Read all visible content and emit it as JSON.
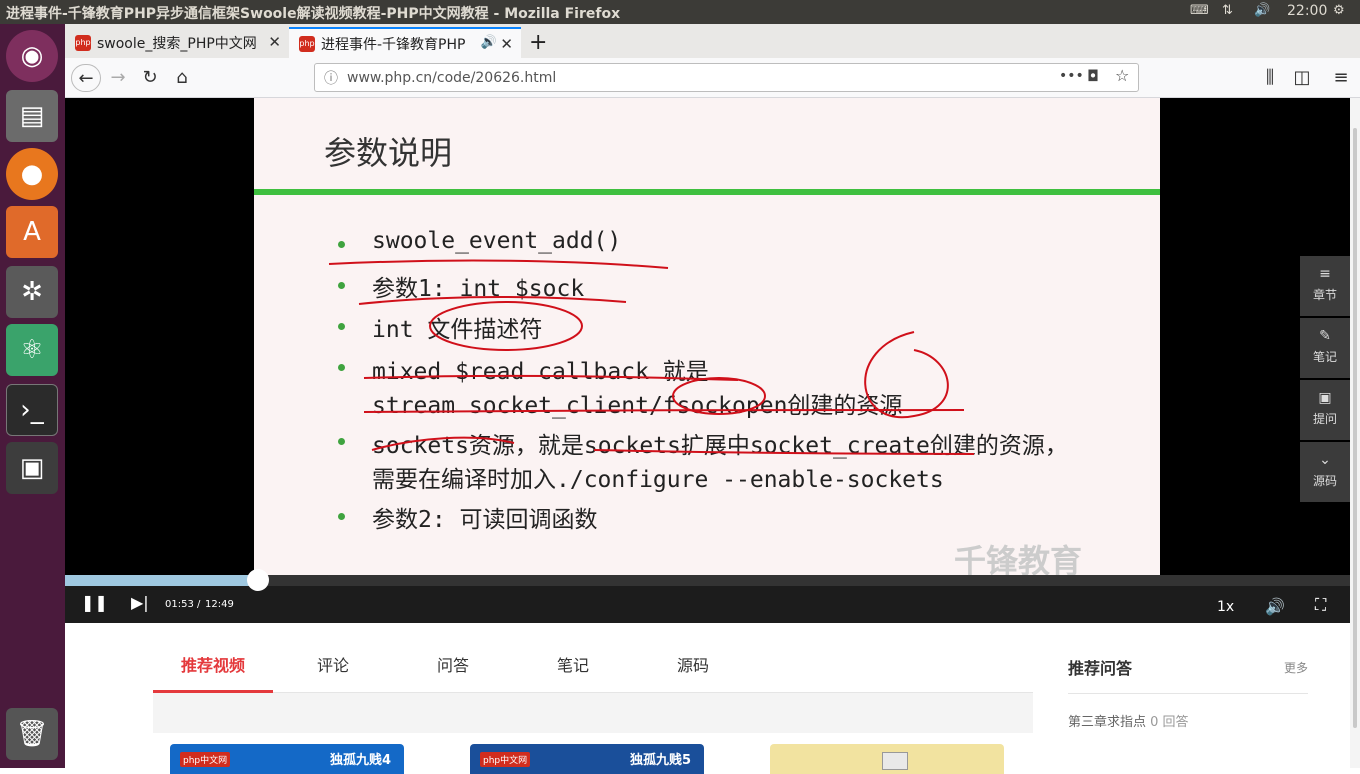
{
  "window_title": "进程事件-千锋教育PHP异步通信框架Swoole解读视频教程-PHP中文网教程 - Mozilla Firefox",
  "clock": "22:00",
  "tabs": [
    {
      "label": "swoole_搜索_PHP中文网"
    },
    {
      "label": "进程事件-千锋教育PHP"
    }
  ],
  "url": "www.php.cn/code/20626.html",
  "slide": {
    "title": "参数说明",
    "bullets": [
      "swoole_event_add()",
      "参数1: int $sock",
      "int 文件描述符",
      "mixed $read callback 就是",
      "stream socket_client/fsockopen创建的资源",
      "sockets资源，就是sockets扩展中socket_create创建的资源，",
      "需要在编译时加入./configure --enable-sockets",
      "参数2: 可读回调函数"
    ],
    "watermark": "千锋教育"
  },
  "player": {
    "time_current": "01:53",
    "time_total": "12:49",
    "speed": "1x",
    "progress": 0.15
  },
  "side_buttons": [
    {
      "label": "章节",
      "icon": "list-icon"
    },
    {
      "label": "笔记",
      "icon": "pencil-icon"
    },
    {
      "label": "提问",
      "icon": "question-icon"
    },
    {
      "label": "源码",
      "icon": "chevron-down-icon"
    }
  ],
  "content_tabs": [
    "推荐视频",
    "评论",
    "问答",
    "笔记",
    "源码"
  ],
  "qa": {
    "title": "推荐问答",
    "more": "更多",
    "item": "第三章求指点",
    "item_count": "0 回答"
  },
  "cards": [
    {
      "text": "独孤九贱4"
    },
    {
      "text": "独孤九贱5"
    }
  ],
  "brand_label": "php中文网"
}
